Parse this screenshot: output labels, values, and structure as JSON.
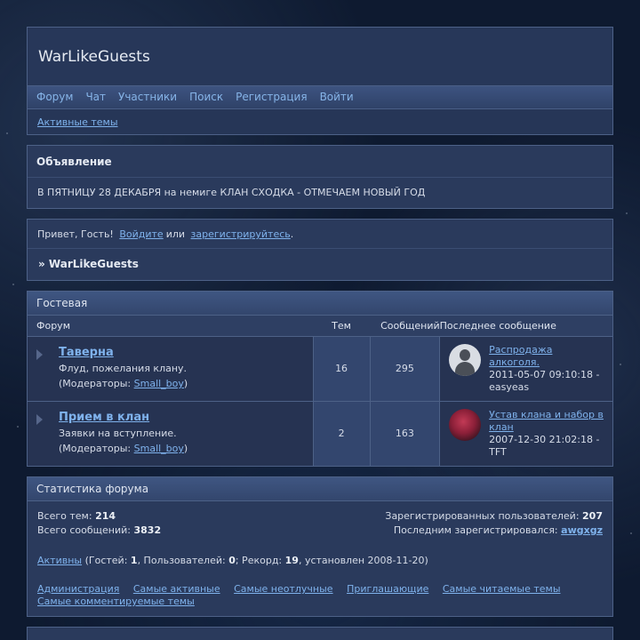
{
  "header": {
    "title": "WarLikeGuests",
    "menu": [
      "Форум",
      "Чат",
      "Участники",
      "Поиск",
      "Регистрация",
      "Войти"
    ],
    "subnav_link": "Активные темы"
  },
  "announcement": {
    "title": "Объявление",
    "body": "В ПЯТНИЦУ 28 ДЕКАБРЯ на немиге КЛАН СХОДКА - ОТМЕЧАЕМ НОВЫЙ ГОД"
  },
  "welcome": {
    "greeting": "Привет, Гость!",
    "login": "Войдите",
    "or": "или",
    "register": "зарегистрируйтесь",
    "period": ".",
    "breadcrumb": "» WarLikeGuests"
  },
  "category": {
    "title": "Гостевая",
    "columns": {
      "forum": "Форум",
      "topics": "Тем",
      "posts": "Сообщений",
      "last": "Последнее сообщение"
    },
    "forums": [
      {
        "name": "Таверна",
        "desc": "Флуд, пожелания клану.",
        "mod_prefix": "(Модераторы:",
        "mod": "Small_boy",
        "mod_suffix": ")",
        "topics": "16",
        "posts": "295",
        "last_topic": "Распродажа алкоголя.",
        "last_date": "2011-05-07 09:10:18 -",
        "last_user": "easyeas"
      },
      {
        "name": "Прием в клан",
        "desc": "Заявки на вступление.",
        "mod_prefix": "(Модераторы:",
        "mod": "Small_boy",
        "mod_suffix": ")",
        "topics": "2",
        "posts": "163",
        "last_topic": "Устав клана и набор в клан",
        "last_date": "2007-12-30 21:02:18 -",
        "last_user": "TFT"
      }
    ]
  },
  "stats": {
    "title": "Статистика форума",
    "total_topics_label": "Всего тем:",
    "total_topics": "214",
    "total_posts_label": "Всего сообщений:",
    "total_posts": "3832",
    "registered_label": "Зарегистрированных пользователей:",
    "registered": "207",
    "last_registered_label": "Последним зарегистрировался:",
    "last_registered": "awgxgz",
    "online_link": "Активны",
    "online_guests_label": "(Гостей:",
    "online_guests": "1",
    "online_users_label": ", Пользователей:",
    "online_users": "0",
    "record_label": "; Рекорд:",
    "record": "19",
    "record_date": ", установлен 2008-11-20)",
    "links": [
      "Администрация",
      "Самые активные",
      "Самые неотлучные",
      "Приглашающие",
      "Самые читаемые темы",
      "Самые комментируемые темы"
    ]
  }
}
